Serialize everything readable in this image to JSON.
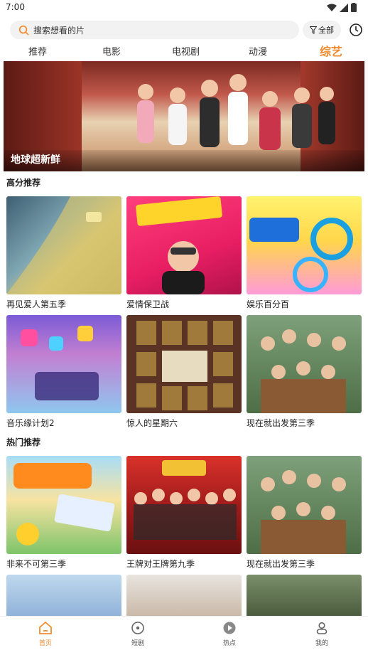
{
  "status_bar": {
    "time": "7:00"
  },
  "search": {
    "placeholder": "搜索想看的片",
    "all_label": "全部"
  },
  "tabs": [
    {
      "label": "推荐",
      "active": false
    },
    {
      "label": "电影",
      "active": false
    },
    {
      "label": "电视剧",
      "active": false
    },
    {
      "label": "动漫",
      "active": false
    },
    {
      "label": "综艺",
      "active": true
    }
  ],
  "banner": {
    "title": "地球超新鲜"
  },
  "sections": {
    "high_score": {
      "title": "高分推荐",
      "items": [
        {
          "title": "再见爱人第五季"
        },
        {
          "title": "爱情保卫战"
        },
        {
          "title": "娱乐百分百"
        },
        {
          "title": "音乐缘计划2"
        },
        {
          "title": "惊人的星期六"
        },
        {
          "title": "现在就出发第三季"
        }
      ]
    },
    "hot": {
      "title": "热门推荐",
      "items": [
        {
          "title": "非来不可第三季"
        },
        {
          "title": "王牌对王牌第九季"
        },
        {
          "title": "现在就出发第三季"
        }
      ]
    }
  },
  "bottom_nav": [
    {
      "label": "首页",
      "icon": "home-icon",
      "active": true
    },
    {
      "label": "短剧",
      "icon": "short-drama-icon",
      "active": false
    },
    {
      "label": "热点",
      "icon": "hot-play-icon",
      "active": false
    },
    {
      "label": "我的",
      "icon": "profile-icon",
      "active": false
    }
  ],
  "colors": {
    "accent": "#f08a2e"
  }
}
